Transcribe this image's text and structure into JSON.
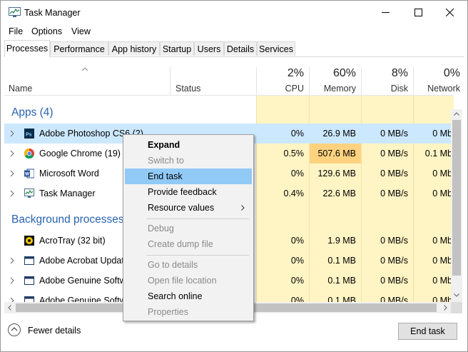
{
  "window": {
    "title": "Task Manager"
  },
  "menu": [
    "File",
    "Options",
    "View"
  ],
  "tabs": [
    "Processes",
    "Performance",
    "App history",
    "Startup",
    "Users",
    "Details",
    "Services"
  ],
  "columns": {
    "name": "Name",
    "status": "Status",
    "cpu": {
      "pct": "2%",
      "label": "CPU"
    },
    "memory": {
      "pct": "60%",
      "label": "Memory"
    },
    "disk": {
      "pct": "8%",
      "label": "Disk"
    },
    "network": {
      "pct": "0%",
      "label": "Network"
    }
  },
  "groups": {
    "apps": "Apps (4)",
    "background": "Background processes"
  },
  "apps": [
    {
      "name": "Adobe Photoshop CS6 (2)",
      "cpu": "0%",
      "memory": "26.9 MB",
      "disk": "0 MB/s",
      "network": "0 Mb",
      "icon": "photoshop-icon"
    },
    {
      "name": "Google Chrome (19)",
      "cpu": "0.5%",
      "memory": "507.6 MB",
      "disk": "0 MB/s",
      "network": "0.1 Mb",
      "icon": "chrome-icon"
    },
    {
      "name": "Microsoft Word",
      "cpu": "0%",
      "memory": "129.6 MB",
      "disk": "0 MB/s",
      "network": "0 Mb",
      "icon": "word-icon"
    },
    {
      "name": "Task Manager",
      "cpu": "0.4%",
      "memory": "22.6 MB",
      "disk": "0 MB/s",
      "network": "0 Mb",
      "icon": "task-manager-icon"
    }
  ],
  "background": [
    {
      "name": "AcroTray (32 bit)",
      "cpu": "0%",
      "memory": "1.9 MB",
      "disk": "0 MB/s",
      "network": "0 Mb",
      "icon": "acrotray-icon"
    },
    {
      "name": "Adobe Acrobat Update",
      "cpu": "0%",
      "memory": "0.1 MB",
      "disk": "0 MB/s",
      "network": "0 Mb",
      "icon": "window-icon"
    },
    {
      "name": "Adobe Genuine Softwa",
      "cpu": "0%",
      "memory": "0.1 MB",
      "disk": "0 MB/s",
      "network": "0 Mb",
      "icon": "window-icon"
    },
    {
      "name": "Adobe Genuine Softwa",
      "cpu": "0%",
      "memory": "0.1 MB",
      "disk": "0 MB/s",
      "network": "0 Mb",
      "icon": "window-icon"
    }
  ],
  "context_menu": {
    "expand": "Expand",
    "switch_to": "Switch to",
    "end_task": "End task",
    "provide_feedback": "Provide feedback",
    "resource_values": "Resource values",
    "debug": "Debug",
    "create_dump": "Create dump file",
    "go_to_details": "Go to details",
    "open_file_location": "Open file location",
    "search_online": "Search online",
    "properties": "Properties"
  },
  "footer": {
    "fewer_details": "Fewer details",
    "end_task": "End task"
  },
  "colors": {
    "accent": "#2a63b0",
    "highlight": "#91c9f7",
    "heat_low": "#fff4c4",
    "heat_high": "#ffd27f",
    "selected_row": "#cce8ff"
  }
}
